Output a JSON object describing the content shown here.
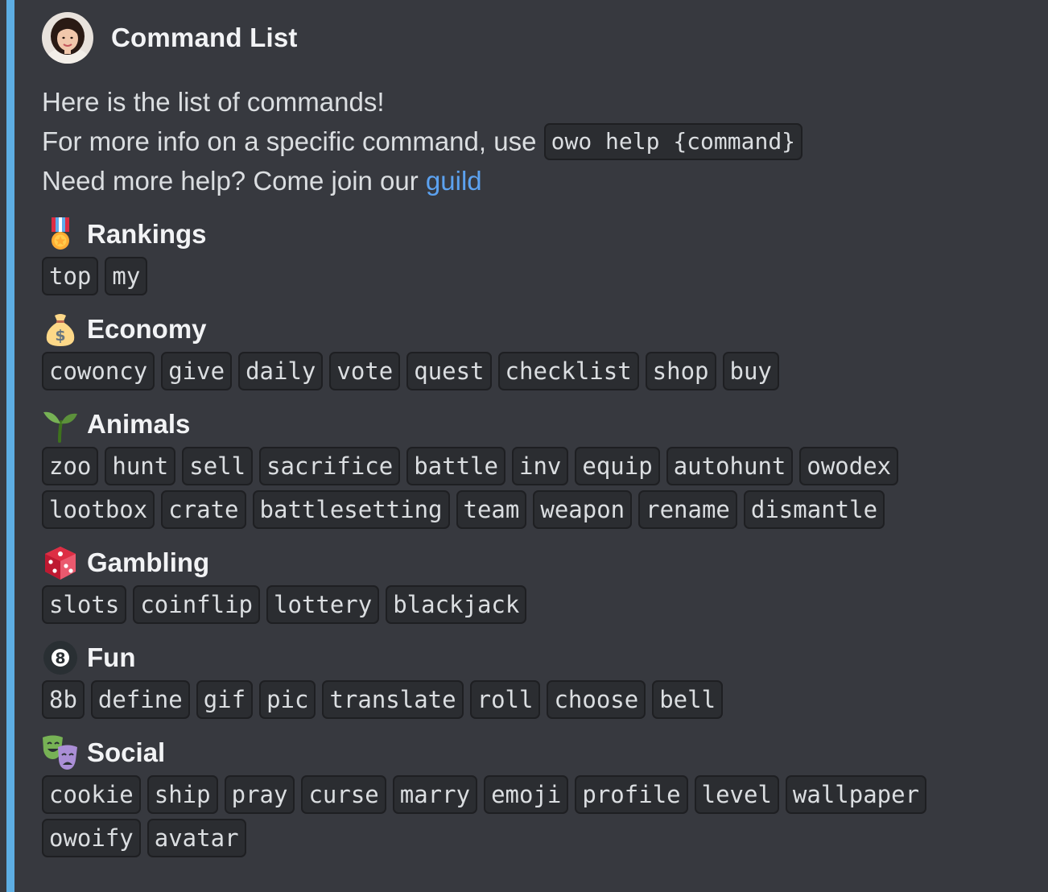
{
  "embed": {
    "accent_color": "#5dade2",
    "author": {
      "name": "Command List",
      "avatar_icon": "user-avatar"
    },
    "description": {
      "line1": "Here is the list of commands!",
      "line2_text": "For more info on a specific command, use ",
      "line2_code": "owo help {command}",
      "line3_text": "Need more help? Come join our ",
      "line3_link": "guild"
    },
    "sections": [
      {
        "icon": "medal-icon",
        "name": "Rankings",
        "commands": [
          "top",
          "my"
        ]
      },
      {
        "icon": "money-bag-icon",
        "name": "Economy",
        "commands": [
          "cowoncy",
          "give",
          "daily",
          "vote",
          "quest",
          "checklist",
          "shop",
          "buy"
        ]
      },
      {
        "icon": "seedling-icon",
        "name": "Animals",
        "commands": [
          "zoo",
          "hunt",
          "sell",
          "sacrifice",
          "battle",
          "inv",
          "equip",
          "autohunt",
          "owodex",
          "lootbox",
          "crate",
          "battlesetting",
          "team",
          "weapon",
          "rename",
          "dismantle"
        ]
      },
      {
        "icon": "die-icon",
        "name": "Gambling",
        "commands": [
          "slots",
          "coinflip",
          "lottery",
          "blackjack"
        ]
      },
      {
        "icon": "8-ball-icon",
        "name": "Fun",
        "commands": [
          "8b",
          "define",
          "gif",
          "pic",
          "translate",
          "roll",
          "choose",
          "bell"
        ]
      },
      {
        "icon": "theater-masks-icon",
        "name": "Social",
        "commands": [
          "cookie",
          "ship",
          "pray",
          "curse",
          "marry",
          "emoji",
          "profile",
          "level",
          "wallpaper",
          "owoify",
          "avatar"
        ]
      }
    ]
  }
}
